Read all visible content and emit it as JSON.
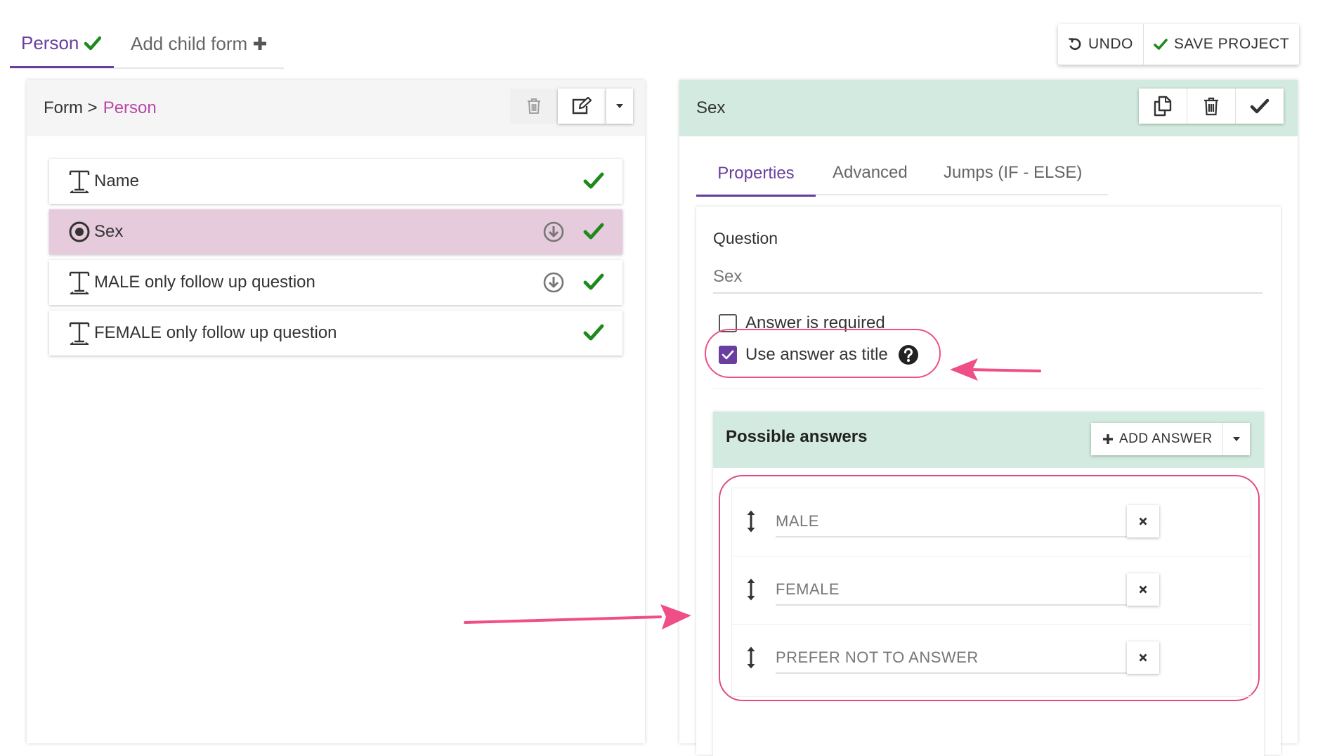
{
  "top_tabs": {
    "active_label": "Person",
    "child_label": "Add child form"
  },
  "top_actions": {
    "undo_label": "UNDO",
    "save_label": "SAVE PROJECT"
  },
  "left": {
    "breadcrumb_root": "Form >",
    "breadcrumb_current": "Person",
    "questions": [
      {
        "label": "Name",
        "type_icon": "text-icon",
        "jump": false,
        "valid": true,
        "selected": false
      },
      {
        "label": "Sex",
        "type_icon": "radio-icon",
        "jump": true,
        "valid": true,
        "selected": true
      },
      {
        "label": "MALE only follow up question",
        "type_icon": "text-icon",
        "jump": true,
        "valid": true,
        "selected": false
      },
      {
        "label": "FEMALE only follow up question",
        "type_icon": "text-icon",
        "jump": false,
        "valid": true,
        "selected": false
      }
    ]
  },
  "right": {
    "title": "Sex",
    "tabs": [
      "Properties",
      "Advanced",
      "Jumps (IF - ELSE)"
    ],
    "question_label": "Question",
    "question_value": "Sex",
    "required_label": "Answer is required",
    "required_checked": false,
    "use_title_label": "Use answer as title",
    "use_title_checked": true,
    "answers_title": "Possible answers",
    "add_answer_label": "ADD ANSWER",
    "answers": [
      "MALE",
      "FEMALE",
      "PREFER NOT TO ANSWER"
    ]
  },
  "colors": {
    "accent": "#6a3ea1",
    "check_green": "#1e8a1e",
    "selected_row": "#e6cbdc",
    "header_green": "#d2eadf",
    "annotation_pink": "#ef4f86"
  }
}
